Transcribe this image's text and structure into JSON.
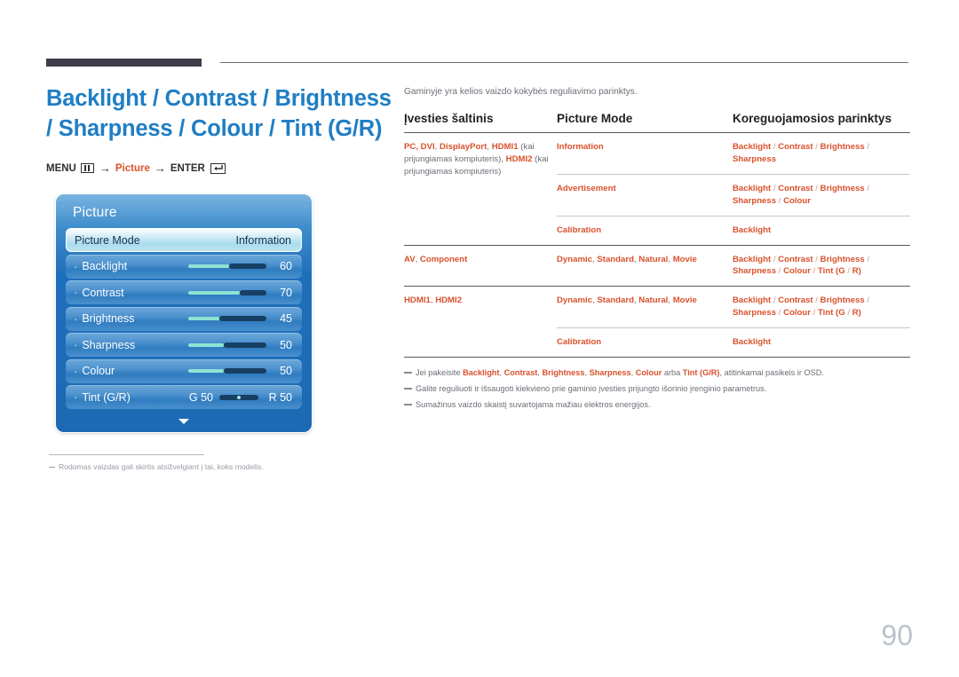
{
  "header": {
    "title": "Backlight / Contrast / Brightness / Sharpness / Colour / Tint (G/R)",
    "menu_path": {
      "menu_label": "MENU",
      "arrow": "→",
      "middle_label": "Picture",
      "enter_label": "ENTER"
    }
  },
  "osd": {
    "title": "Picture",
    "rows": [
      {
        "label": "Picture Mode",
        "value": "Information",
        "type": "highlight"
      },
      {
        "label": "Backlight",
        "value": "60",
        "type": "slider",
        "fill_percent": 60
      },
      {
        "label": "Contrast",
        "value": "70",
        "type": "slider",
        "fill_percent": 70
      },
      {
        "label": "Brightness",
        "value": "45",
        "type": "slider",
        "fill_percent": 45
      },
      {
        "label": "Sharpness",
        "value": "50",
        "type": "slider",
        "fill_percent": 50
      },
      {
        "label": "Colour",
        "value": "50",
        "type": "slider",
        "fill_percent": 50
      },
      {
        "label": "Tint (G/R)",
        "value_left": "G 50",
        "value_right": "R 50",
        "type": "tint"
      }
    ],
    "scroll_down_icon": "caret-down"
  },
  "left_note": {
    "text": "Rodomas vaizdas gali skirtis atsižvelgiant į tai, koks modelis."
  },
  "main": {
    "intro": "Gaminyje yra kelios vaizdo kokybės reguliavimo parinktys.",
    "table": {
      "headers": [
        "Įvesties šaltinis",
        "Picture Mode",
        "Koreguojamosios parinktys"
      ],
      "rows": [
        {
          "source_parts": [
            {
              "t": "PC",
              "s": "b"
            },
            {
              "t": ", ",
              "s": "b"
            },
            {
              "t": "DVI",
              "s": "b"
            },
            {
              "t": ", ",
              "s": "g"
            },
            {
              "t": "DisplayPort",
              "s": "b"
            },
            {
              "t": ", ",
              "s": "g"
            },
            {
              "t": "HDMI1",
              "s": "b"
            },
            {
              "t": " (kai prijungiamas kompiuteris), ",
              "s": "g"
            },
            {
              "t": "HDMI2",
              "s": "b"
            },
            {
              "t": " (kai prijungiamas kompiuteris)",
              "s": "g"
            }
          ],
          "mode": "Information",
          "options": "Backlight / Contrast / Brightness / Sharpness",
          "divider": "thick"
        },
        {
          "source_parts": [],
          "mode": "Advertisement",
          "options": "Backlight / Contrast / Brightness / Sharpness / Colour",
          "divider": "thin"
        },
        {
          "source_parts": [],
          "mode": "Calibration",
          "options": "Backlight",
          "divider": "thin"
        },
        {
          "source_parts": [
            {
              "t": "AV",
              "s": "b"
            },
            {
              "t": ", ",
              "s": "g"
            },
            {
              "t": "Component",
              "s": "b"
            }
          ],
          "mode": "Dynamic, Standard, Natural, Movie",
          "options": "Backlight / Contrast / Brightness / Sharpness / Colour / Tint (G/R)",
          "divider": "thick"
        },
        {
          "source_parts": [
            {
              "t": "HDMI1",
              "s": "b"
            },
            {
              "t": ", ",
              "s": "g"
            },
            {
              "t": "HDMI2",
              "s": "b"
            }
          ],
          "mode": "Dynamic, Standard, Natural, Movie",
          "options": "Backlight / Contrast / Brightness / Sharpness / Colour / Tint (G/R)",
          "divider": "thick"
        },
        {
          "source_parts": [],
          "mode": "Calibration",
          "options": "Backlight",
          "divider": "thin"
        }
      ]
    },
    "footnotes": [
      {
        "parts": [
          {
            "t": "Jei pakeisite ",
            "s": "g"
          },
          {
            "t": "Backlight",
            "s": "b"
          },
          {
            "t": ", ",
            "s": "g"
          },
          {
            "t": "Contrast",
            "s": "b"
          },
          {
            "t": ", ",
            "s": "g"
          },
          {
            "t": "Brightness",
            "s": "b"
          },
          {
            "t": ", ",
            "s": "g"
          },
          {
            "t": "Sharpness",
            "s": "b"
          },
          {
            "t": ", ",
            "s": "g"
          },
          {
            "t": "Colour",
            "s": "b"
          },
          {
            "t": "  arba ",
            "s": "g"
          },
          {
            "t": "Tint (G/R)",
            "s": "b"
          },
          {
            "t": ", atitinkamai pasikeis ir OSD.",
            "s": "g"
          }
        ]
      },
      {
        "parts": [
          {
            "t": "Galite reguliuoti ir išsaugoti kiekvieno prie gaminio įvesties prijungto išorinio įrenginio parametrus.",
            "s": "g"
          }
        ]
      },
      {
        "parts": [
          {
            "t": "Sumažinus vaizdo skaistį suvartojama mažiau elektros energijos.",
            "s": "g"
          }
        ]
      }
    ]
  },
  "page_number": "90",
  "colors": {
    "title_blue": "#1f7ec4",
    "accent_orange": "#d9512c",
    "gray_text": "#6e6c76",
    "osd_blue": "#1e6fba"
  }
}
